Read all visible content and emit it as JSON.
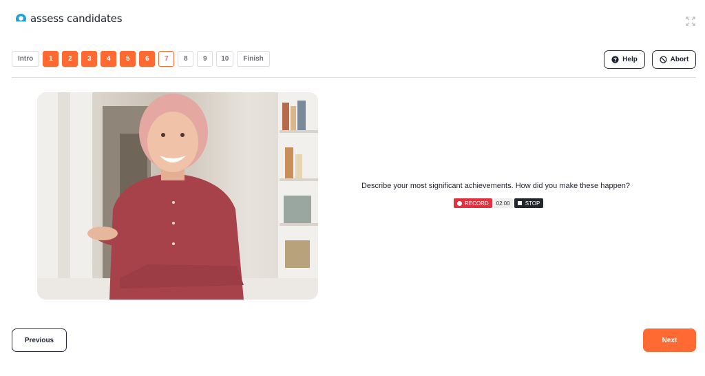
{
  "brand": {
    "name": "assess candidates",
    "logo_icon": "circle-c-logo",
    "color": "#1fa3d6"
  },
  "header": {
    "fullscreen_icon": "expand-icon"
  },
  "steps": {
    "intro": "Intro",
    "numbers": [
      "1",
      "2",
      "3",
      "4",
      "5",
      "6",
      "7",
      "8",
      "9",
      "10"
    ],
    "finish": "Finish",
    "completed_count": 6,
    "current": "7"
  },
  "actions": {
    "help_label": "Help",
    "help_icon": "question-circle-icon",
    "abort_label": "Abort",
    "abort_icon": "prohibited-icon"
  },
  "question": {
    "text": "Describe your most significant achievements. How did you make these happen?"
  },
  "recorder": {
    "record_label": "RECORD",
    "timer": "02:00",
    "stop_label": "STOP"
  },
  "footer": {
    "previous_label": "Previous",
    "next_label": "Next"
  },
  "colors": {
    "accent": "#ff6a33",
    "record": "#e0313f",
    "dark": "#23262d"
  }
}
